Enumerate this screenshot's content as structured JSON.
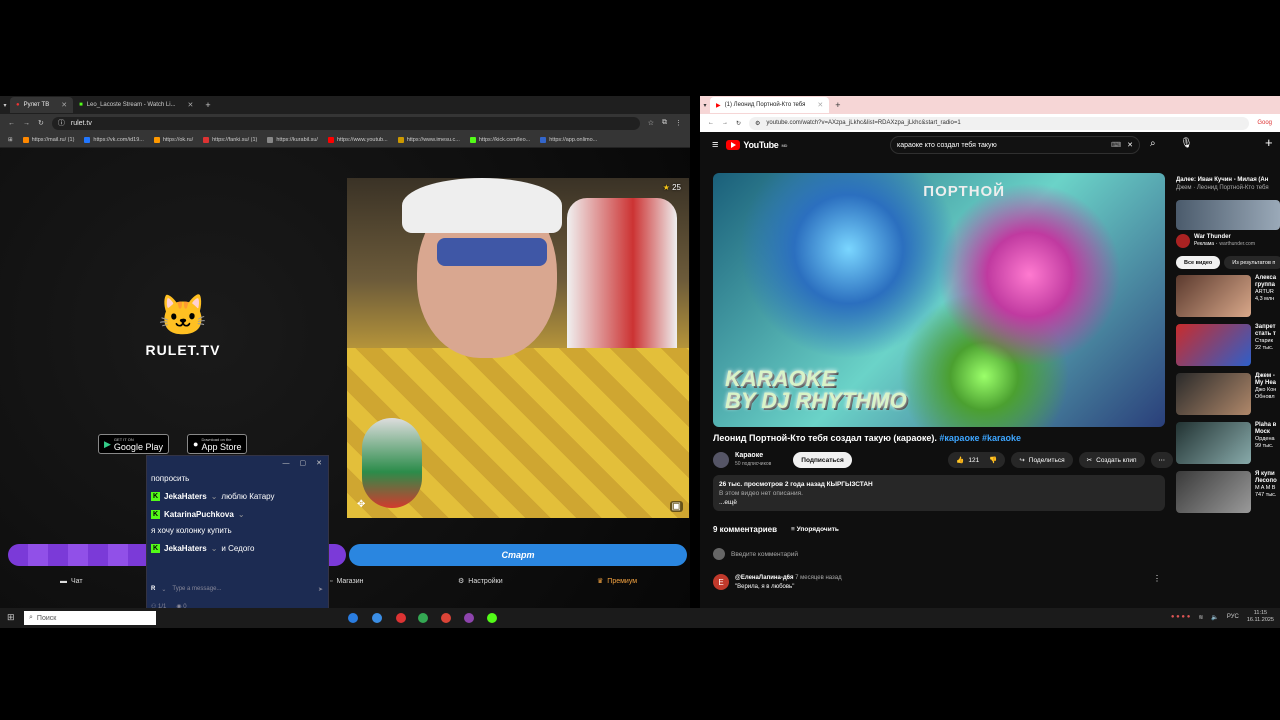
{
  "left_browser": {
    "tabs": [
      {
        "label": "Рулет ТВ",
        "active": true
      },
      {
        "label": "Leo_Lacoste Stream - Watch Li...",
        "active": false
      }
    ],
    "url": "rulet.tv",
    "bookmarks": [
      "https://mail.ru/ (1)",
      "https://vk.com/id19...",
      "https://ok.ru/",
      "https://fanki.su/ (1)",
      "https://kurabil.su/",
      "https://www.youtub...",
      "https://www.imesu.c...",
      "https://kick.com/leo...",
      "https://app.onlimo..."
    ],
    "site": {
      "logo_text": "RULET.TV",
      "google_play_small": "GET IT ON",
      "google_play": "Google Play",
      "app_store_small": "Download on the",
      "app_store": "App Store",
      "viewers": "25",
      "start_button": "Старт",
      "menu": {
        "chat": "Чат",
        "shop": "Магазин",
        "settings": "Настройки",
        "premium": "Премиум"
      }
    },
    "chat": {
      "messages": [
        {
          "user": "",
          "text": "попросить"
        },
        {
          "user": "JekaHaters",
          "text": "люблю Катару"
        },
        {
          "user": "KatarinaPuchkova",
          "text": "я хочу колонку купить"
        },
        {
          "user": "JekaHaters",
          "text": "и Седого"
        }
      ],
      "input_placeholder": "Type a message...",
      "input_prefix": "R",
      "stats_users": "1/1",
      "stats_views": "0"
    }
  },
  "right_browser": {
    "tab": "(1) Леонид Портной-Кто тебя",
    "url": "youtube.com/watch?v=AXzpa_jLkhc&list=RDAXzpa_jLkhc&start_radio=1",
    "side_label": "Goog",
    "youtube": {
      "logo": "YouTube",
      "region": "MD",
      "search_value": "караоке кто создал тебя такую",
      "video_text_top": "ПОРТНОЙ",
      "video_text_line1": "KARAOKE",
      "video_text_line2": "BY DJ RHYTHMO",
      "title": "Леонид Портной-Кто тебя создал такую (караоке).",
      "tags": "#караоке #karaoke",
      "channel_name": "Караоке",
      "channel_subs": "50 подписчиков",
      "subscribe": "Подписаться",
      "likes": "121",
      "share": "Поделиться",
      "clip": "Создать клип",
      "desc_stats": "26 тыс. просмотров  2 года назад  КЫРГЫЗСТАН",
      "desc_text": "В этом видео нет описания.",
      "desc_more": "...ещё",
      "comments_count": "9 комментариев",
      "sort": "Упорядочить",
      "add_comment": "Введите комментарий",
      "first_comment_author": "@ЕленаЛапина-д6я",
      "first_comment_time": "7 месяцев назад",
      "first_comment_text": "\"Верила, я в любовь\"",
      "sidebar": {
        "next": "Далее: Иван Кучин - Милая (Ан",
        "next_sub": "Джем · Леонид Портной-Кто тебя",
        "ad_title": "War Thunder",
        "ad_label": "Реклама",
        "ad_domain": "warthunder.com",
        "chip_all": "Все видео",
        "chip_results": "Из результатов п",
        "items": [
          {
            "title": "Алекса группа",
            "meta": "ARTUR",
            "meta2": "4,3 млн",
            "duration": "2:49"
          },
          {
            "title": "Запрет стать т",
            "meta": "Старик",
            "meta2": "22 тыс.",
            "duration": "21:40"
          },
          {
            "title": "Джем - My Hea",
            "meta": "Джо Кон",
            "meta2": "Обновл",
            "duration": "Джем"
          },
          {
            "title": "Plaha в Моск",
            "meta": "Ордена",
            "meta2": "99 тыс.",
            "duration": "14:39"
          },
          {
            "title": "Я купи Лесопо",
            "meta": "M A M B",
            "meta2": "747 тыс.",
            "duration": "4:37"
          },
          {
            "title": "Nicolae",
            "meta": "Arena M",
            "meta2": "3,2 млн",
            "duration": ""
          }
        ]
      }
    }
  },
  "taskbar": {
    "search": "Поиск",
    "lang": "РУС",
    "time": "11:15",
    "date": "16.11.2025"
  }
}
